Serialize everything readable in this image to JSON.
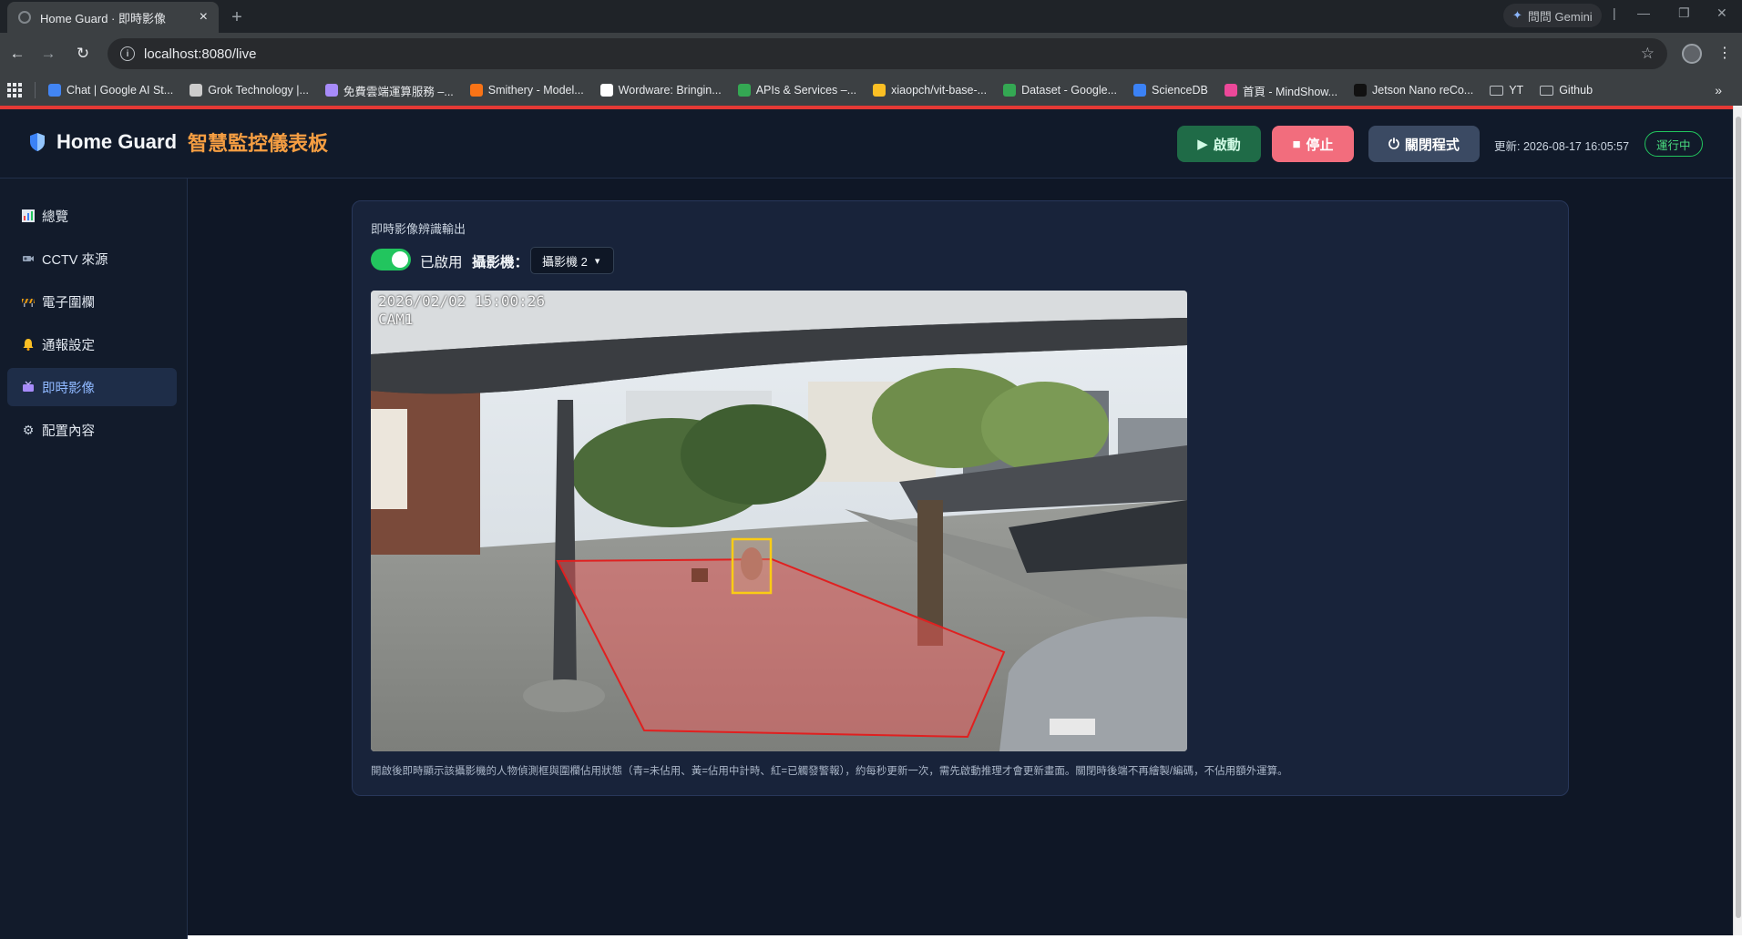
{
  "browser": {
    "tab_title": "Home Guard · 即時影像",
    "close_glyph": "×",
    "new_tab_glyph": "+",
    "gemini_label": "問問 Gemini",
    "url": "localhost:8080/live",
    "bookmarks": [
      {
        "label": "Chat | Google AI St...",
        "color": "#4285f4"
      },
      {
        "label": "Grok Technology |...",
        "color": "#cccccc"
      },
      {
        "label": "免費雲端運算服務 –...",
        "color": "#a78bfa"
      },
      {
        "label": "Smithery - Model...",
        "color": "#f97316"
      },
      {
        "label": "Wordware: Bringin...",
        "color": "#ffffff"
      },
      {
        "label": "APIs & Services –...",
        "color": "#34a853"
      },
      {
        "label": "xiaopch/vit-base-...",
        "color": "#fbbf24"
      },
      {
        "label": "Dataset - Google...",
        "color": "#34a853"
      },
      {
        "label": "ScienceDB",
        "color": "#3b82f6"
      },
      {
        "label": "首頁 - MindShow...",
        "color": "#ec4899"
      },
      {
        "label": "Jetson Nano reCo...",
        "color": "#111111"
      }
    ],
    "folders": [
      "YT",
      "Github"
    ]
  },
  "header": {
    "brand_title": "Home Guard",
    "brand_subtitle": "智慧監控儀表板",
    "start_label": "啟動",
    "stop_label": "停止",
    "shutdown_label": "關閉程式",
    "updated_text": "更新: 2026-08-17 16:05:57",
    "status_text": "運行中",
    "colors": {
      "accent": "#f59e42",
      "start": "#1f6b47",
      "stop": "#f26d7d",
      "status": "#22c55e"
    }
  },
  "sidebar": {
    "items": [
      {
        "label": "總覽",
        "icon": "chart-icon"
      },
      {
        "label": "CCTV 來源",
        "icon": "cctv-camera-icon"
      },
      {
        "label": "電子圍欄",
        "icon": "barrier-icon"
      },
      {
        "label": "通報設定",
        "icon": "bell-icon"
      },
      {
        "label": "即時影像",
        "icon": "live-video-icon",
        "active": true
      },
      {
        "label": "配置內容",
        "icon": "gear-icon"
      }
    ]
  },
  "panel": {
    "title": "即時影像辨識輸出",
    "toggle_on": true,
    "toggle_label": "已啟用",
    "camera_label": "攝影機：",
    "camera_selected": "攝影機 2",
    "osd_timestamp": "2026/02/02  15:00:26",
    "osd_camera": "CAM1",
    "caption": "開啟後即時顯示該攝影機的人物偵測框與圍欄佔用狀態（青=未佔用、黃=佔用中計時、紅=已觸發警報），約每秒更新一次，需先啟動推理才會更新畫面。關閉時後端不再繪製/編碼，不佔用額外運算。"
  }
}
